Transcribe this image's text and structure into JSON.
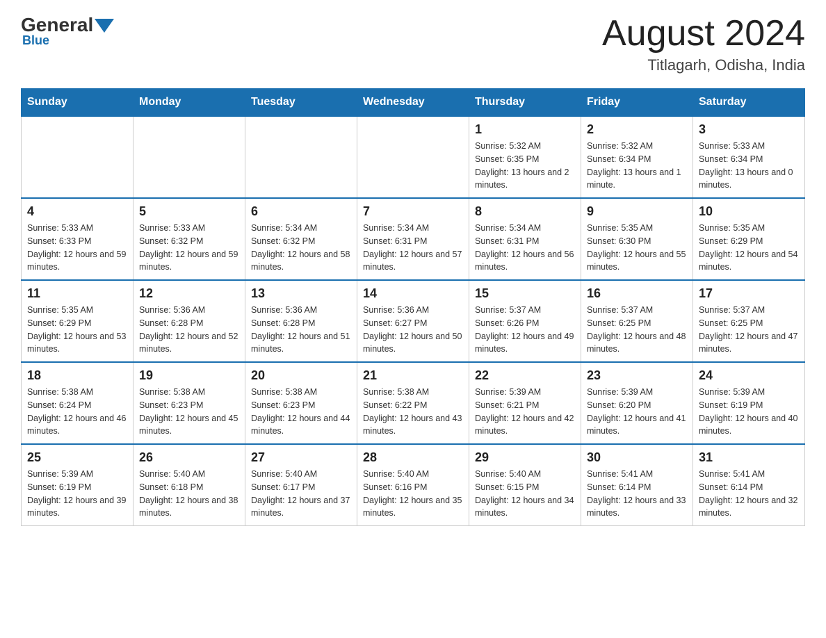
{
  "logo": {
    "general": "General",
    "blue": "Blue"
  },
  "title": "August 2024",
  "subtitle": "Titlagarh, Odisha, India",
  "days_of_week": [
    "Sunday",
    "Monday",
    "Tuesday",
    "Wednesday",
    "Thursday",
    "Friday",
    "Saturday"
  ],
  "weeks": [
    [
      {
        "day": "",
        "info": ""
      },
      {
        "day": "",
        "info": ""
      },
      {
        "day": "",
        "info": ""
      },
      {
        "day": "",
        "info": ""
      },
      {
        "day": "1",
        "info": "Sunrise: 5:32 AM\nSunset: 6:35 PM\nDaylight: 13 hours and 2 minutes."
      },
      {
        "day": "2",
        "info": "Sunrise: 5:32 AM\nSunset: 6:34 PM\nDaylight: 13 hours and 1 minute."
      },
      {
        "day": "3",
        "info": "Sunrise: 5:33 AM\nSunset: 6:34 PM\nDaylight: 13 hours and 0 minutes."
      }
    ],
    [
      {
        "day": "4",
        "info": "Sunrise: 5:33 AM\nSunset: 6:33 PM\nDaylight: 12 hours and 59 minutes."
      },
      {
        "day": "5",
        "info": "Sunrise: 5:33 AM\nSunset: 6:32 PM\nDaylight: 12 hours and 59 minutes."
      },
      {
        "day": "6",
        "info": "Sunrise: 5:34 AM\nSunset: 6:32 PM\nDaylight: 12 hours and 58 minutes."
      },
      {
        "day": "7",
        "info": "Sunrise: 5:34 AM\nSunset: 6:31 PM\nDaylight: 12 hours and 57 minutes."
      },
      {
        "day": "8",
        "info": "Sunrise: 5:34 AM\nSunset: 6:31 PM\nDaylight: 12 hours and 56 minutes."
      },
      {
        "day": "9",
        "info": "Sunrise: 5:35 AM\nSunset: 6:30 PM\nDaylight: 12 hours and 55 minutes."
      },
      {
        "day": "10",
        "info": "Sunrise: 5:35 AM\nSunset: 6:29 PM\nDaylight: 12 hours and 54 minutes."
      }
    ],
    [
      {
        "day": "11",
        "info": "Sunrise: 5:35 AM\nSunset: 6:29 PM\nDaylight: 12 hours and 53 minutes."
      },
      {
        "day": "12",
        "info": "Sunrise: 5:36 AM\nSunset: 6:28 PM\nDaylight: 12 hours and 52 minutes."
      },
      {
        "day": "13",
        "info": "Sunrise: 5:36 AM\nSunset: 6:28 PM\nDaylight: 12 hours and 51 minutes."
      },
      {
        "day": "14",
        "info": "Sunrise: 5:36 AM\nSunset: 6:27 PM\nDaylight: 12 hours and 50 minutes."
      },
      {
        "day": "15",
        "info": "Sunrise: 5:37 AM\nSunset: 6:26 PM\nDaylight: 12 hours and 49 minutes."
      },
      {
        "day": "16",
        "info": "Sunrise: 5:37 AM\nSunset: 6:25 PM\nDaylight: 12 hours and 48 minutes."
      },
      {
        "day": "17",
        "info": "Sunrise: 5:37 AM\nSunset: 6:25 PM\nDaylight: 12 hours and 47 minutes."
      }
    ],
    [
      {
        "day": "18",
        "info": "Sunrise: 5:38 AM\nSunset: 6:24 PM\nDaylight: 12 hours and 46 minutes."
      },
      {
        "day": "19",
        "info": "Sunrise: 5:38 AM\nSunset: 6:23 PM\nDaylight: 12 hours and 45 minutes."
      },
      {
        "day": "20",
        "info": "Sunrise: 5:38 AM\nSunset: 6:23 PM\nDaylight: 12 hours and 44 minutes."
      },
      {
        "day": "21",
        "info": "Sunrise: 5:38 AM\nSunset: 6:22 PM\nDaylight: 12 hours and 43 minutes."
      },
      {
        "day": "22",
        "info": "Sunrise: 5:39 AM\nSunset: 6:21 PM\nDaylight: 12 hours and 42 minutes."
      },
      {
        "day": "23",
        "info": "Sunrise: 5:39 AM\nSunset: 6:20 PM\nDaylight: 12 hours and 41 minutes."
      },
      {
        "day": "24",
        "info": "Sunrise: 5:39 AM\nSunset: 6:19 PM\nDaylight: 12 hours and 40 minutes."
      }
    ],
    [
      {
        "day": "25",
        "info": "Sunrise: 5:39 AM\nSunset: 6:19 PM\nDaylight: 12 hours and 39 minutes."
      },
      {
        "day": "26",
        "info": "Sunrise: 5:40 AM\nSunset: 6:18 PM\nDaylight: 12 hours and 38 minutes."
      },
      {
        "day": "27",
        "info": "Sunrise: 5:40 AM\nSunset: 6:17 PM\nDaylight: 12 hours and 37 minutes."
      },
      {
        "day": "28",
        "info": "Sunrise: 5:40 AM\nSunset: 6:16 PM\nDaylight: 12 hours and 35 minutes."
      },
      {
        "day": "29",
        "info": "Sunrise: 5:40 AM\nSunset: 6:15 PM\nDaylight: 12 hours and 34 minutes."
      },
      {
        "day": "30",
        "info": "Sunrise: 5:41 AM\nSunset: 6:14 PM\nDaylight: 12 hours and 33 minutes."
      },
      {
        "day": "31",
        "info": "Sunrise: 5:41 AM\nSunset: 6:14 PM\nDaylight: 12 hours and 32 minutes."
      }
    ]
  ]
}
